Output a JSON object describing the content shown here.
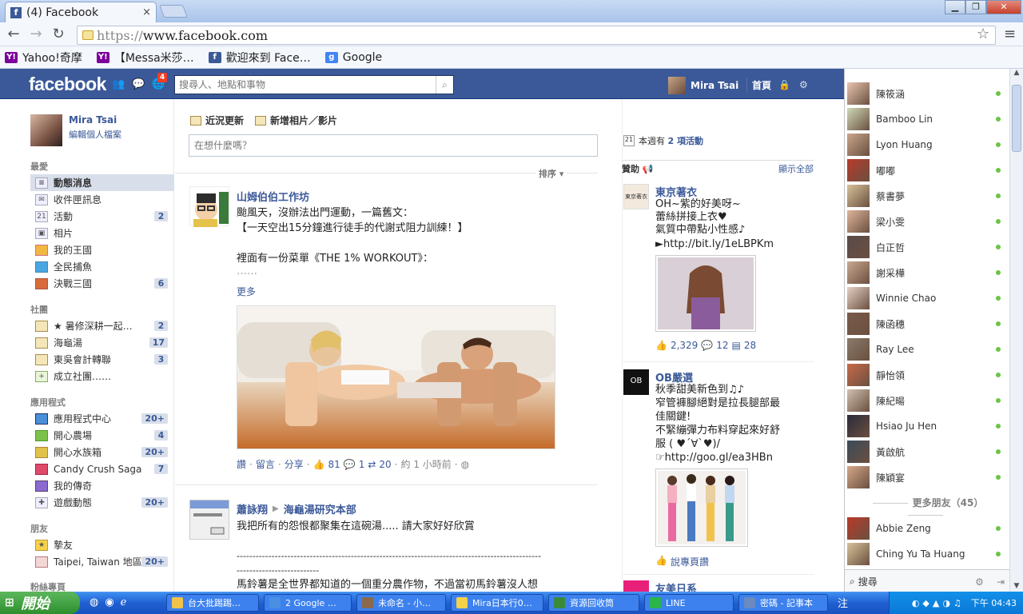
{
  "browser": {
    "tab_title": "(4) Facebook",
    "tab_close": "×",
    "url_protocol": "https://",
    "url_host": "www.facebook.com",
    "bookmarks": [
      {
        "label": "Yahoo!奇摩",
        "icon": "yahoo-icon"
      },
      {
        "label": "【Messa米莎…",
        "icon": "yahoo-icon"
      },
      {
        "label": "歡迎來到 Face…",
        "icon": "facebook-icon"
      },
      {
        "label": "Google",
        "icon": "google-icon"
      }
    ]
  },
  "fb": {
    "logo": "facebook",
    "notif_count": "4",
    "search_placeholder": "搜尋人、地點和事物",
    "user_name": "Mira Tsai",
    "home": "首頁"
  },
  "left": {
    "profile_name": "Mira Tsai",
    "profile_edit": "編輯個人檔案",
    "sections": {
      "favorites": "最愛",
      "groups": "社團",
      "apps": "應用程式",
      "friends": "朋友",
      "pages": "粉絲專頁"
    },
    "favorites": [
      {
        "label": "動態消息",
        "count": ""
      },
      {
        "label": "收件匣訊息",
        "count": ""
      },
      {
        "label": "活動",
        "count": "2"
      },
      {
        "label": "相片",
        "count": ""
      },
      {
        "label": "我的王國",
        "count": ""
      },
      {
        "label": "全民捕魚",
        "count": ""
      },
      {
        "label": "決戰三國",
        "count": "6"
      }
    ],
    "groups": [
      {
        "label": "★ 暑修深耕一起…",
        "count": "2"
      },
      {
        "label": "海龜湯",
        "count": "17"
      },
      {
        "label": "東吳會計轉聯",
        "count": "3"
      },
      {
        "label": "成立社團……",
        "count": ""
      }
    ],
    "apps": [
      {
        "label": "應用程式中心",
        "count": "20+"
      },
      {
        "label": "開心農場",
        "count": "4"
      },
      {
        "label": "開心水族箱",
        "count": "20+"
      },
      {
        "label": "Candy Crush Saga",
        "count": "7"
      },
      {
        "label": "我的傳奇",
        "count": ""
      },
      {
        "label": "遊戲動態",
        "count": "20+"
      }
    ],
    "friends": [
      {
        "label": "摯友",
        "count": ""
      },
      {
        "label": "Taipei, Taiwan 地區",
        "count": "20+"
      }
    ]
  },
  "composer": {
    "tab_status": "近況更新",
    "tab_photo": "新增相片／影片",
    "placeholder": "在想什麼嗎？",
    "sort": "排序"
  },
  "post1": {
    "author": "山姆伯伯工作坊",
    "line1": "颱風天，沒辦法出門運動，一篇舊文：",
    "line2": "【一天空出15分鐘進行徒手的代謝式阻力訓練！】",
    "line3": "裡面有一份菜單《THE 1% WORKOUT》：",
    "line4": "……",
    "more": "更多",
    "like": "讚",
    "comment": "留言",
    "share": "分享",
    "likes": "81",
    "comments": "1",
    "shares": "20",
    "time": "約 1 小時前"
  },
  "post2": {
    "author": "蕭詠翔",
    "target": "海龜湯研究本部",
    "line1": "我把所有的怨恨都聚集在這碗湯..... 請大家好好欣賞",
    "dashes": "------------------------------------------------------------------------------------------------",
    "dashes2": "--------------------------",
    "line2": "馬鈴薯是全世界都知道的一個重分農作物，不過當初馬鈴薯沒人想"
  },
  "right": {
    "events_prefix": "本週有",
    "events_bold": "2 項活動",
    "sponsored": "贊助",
    "see_all": "顯示全部",
    "ad1_title": "東京著衣",
    "ad1_l1": "OH~紫的好美呀~",
    "ad1_l2": "蕾絲拼接上衣♥",
    "ad1_l3": "氣質中帶點小性感♪",
    "ad1_link": "►http://bit.ly/1eLBPKm",
    "ad1_likes": "2,329",
    "ad1_comments": "12",
    "ad1_shares": "28",
    "ad2_title": "OB嚴選",
    "ad2_l1": "秋季甜美新色到♫♪",
    "ad2_l2": "窄管褲腳絕對是拉長腿部最",
    "ad2_l3": "佳關鍵!",
    "ad2_l4": "不緊繃彈力布料穿起來好舒",
    "ad2_l5": "服 ( ♥´∀`♥)/",
    "ad2_link": "☞http://goo.gl/ea3HBn",
    "ad2_cta": "說專頁讚",
    "ad3_title": "友美日系"
  },
  "chat": {
    "friends": [
      "陳筱涵",
      "Bamboo Lin",
      "Lyon Huang",
      "嘟嘟",
      "蔡書夢",
      "梁小雯",
      "白正哲",
      "謝采樺",
      "Winnie Chao",
      "陳函穗",
      "Ray Lee",
      "靜怡領",
      "陳紀暘",
      "Hsiao Ju Hen",
      "黃啟航",
      "陳穎宴"
    ],
    "more": "更多朋友（45）",
    "more_friends": [
      "Abbie Zeng",
      "Ching Yu Ta Huang"
    ],
    "search": "搜尋"
  },
  "taskbar": {
    "start": "開始",
    "items": [
      "台大批踢踢…",
      "2 Google …",
      "未命名 - 小…",
      "Mira日本行0…",
      "資源回收筒",
      "LINE",
      "密碼 - 記事本"
    ],
    "clock": "下午 04:43",
    "ime": "注"
  }
}
